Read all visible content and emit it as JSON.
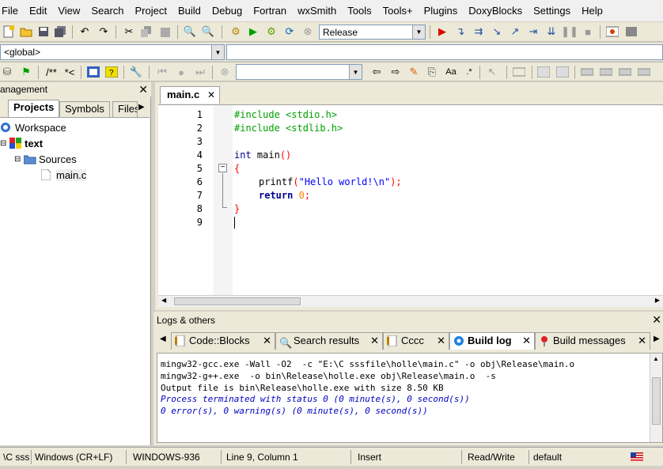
{
  "menubar": [
    "File",
    "Edit",
    "View",
    "Search",
    "Project",
    "Build",
    "Debug",
    "Fortran",
    "wxSmith",
    "Tools",
    "Tools+",
    "Plugins",
    "DoxyBlocks",
    "Settings",
    "Help"
  ],
  "toolbar": {
    "build_target": "Release",
    "scope": "<global>",
    "doc_comment": "/**",
    "doc_inline": "*<",
    "search_value": ""
  },
  "management": {
    "title": "anagement",
    "tabs": [
      "Projects",
      "Symbols",
      "Files"
    ],
    "tree": {
      "workspace": "Workspace",
      "project": "text",
      "folder": "Sources",
      "file": "main.c"
    }
  },
  "editor": {
    "tab": "main.c",
    "line_numbers": [
      "1",
      "2",
      "3",
      "4",
      "5",
      "6",
      "7",
      "8",
      "9"
    ],
    "code": {
      "l1": "#include <stdio.h>",
      "l2": "#include <stdlib.h>",
      "l4_kw": "int",
      "l4_rest": " main",
      "l4_paren": "()",
      "l5": "{",
      "l6_fn": "printf",
      "l6_p1": "(",
      "l6_str": "\"Hello world!\\n\"",
      "l6_p2": ");",
      "l7_kw": "return",
      "l7_num": "0",
      "l7_semi": ";",
      "l8": "}"
    }
  },
  "logs": {
    "title": "Logs & others",
    "tabs": [
      "Code::Blocks",
      "Search results",
      "Cccc",
      "Build log",
      "Build messages"
    ],
    "lines": [
      "mingw32-gcc.exe -Wall -O2  -c \"E:\\C sssfile\\holle\\main.c\" -o obj\\Release\\main.o",
      "mingw32-g++.exe  -o bin\\Release\\holle.exe obj\\Release\\main.o  -s",
      "Output file is bin\\Release\\holle.exe with size 8.50 KB",
      "Process terminated with status 0 (0 minute(s), 0 second(s))",
      "0 error(s), 0 warning(s) (0 minute(s), 0 second(s))"
    ]
  },
  "status": {
    "path": "\\C sss",
    "eol": "Windows (CR+LF)",
    "encoding": "WINDOWS-936",
    "position": "Line 9, Column 1",
    "mode": "Insert",
    "access": "Read/Write",
    "lang": "default"
  },
  "colors": {
    "preprocessor": "#00a000",
    "keyword": "#00008b",
    "string": "#0000ff",
    "number": "#ff8000",
    "operator": "#ff0000"
  }
}
